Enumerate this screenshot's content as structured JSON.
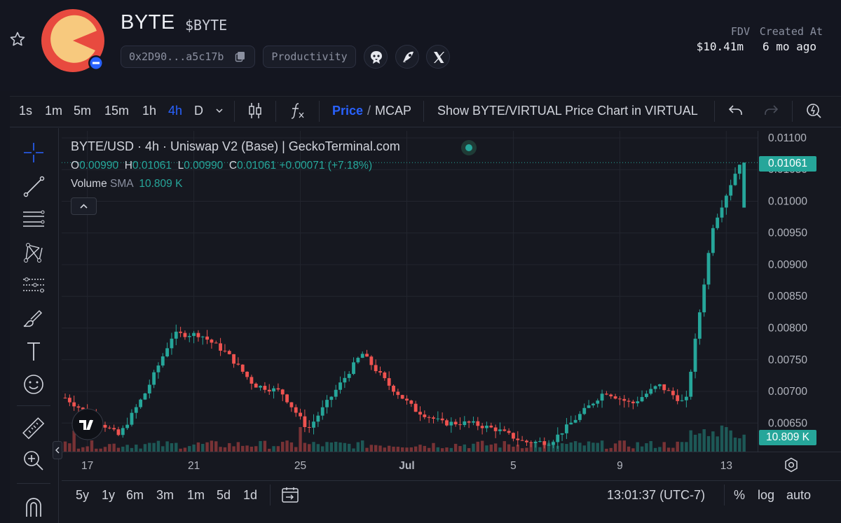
{
  "token": {
    "name": "BYTE",
    "symbol": "$BYTE",
    "address": "0x2D90...a5c17b",
    "category": "Productivity",
    "stats": [
      {
        "label": "FDV",
        "value": "$10.41m"
      },
      {
        "label": "Created At",
        "value": "6 mo ago"
      }
    ],
    "icons": [
      "star-icon",
      "copy-icon",
      "eagle-icon",
      "rocket-icon",
      "x-logo-icon"
    ],
    "logo_colors": {
      "ring": "#e84a3f",
      "face": "#f7c97e",
      "badge": "#2962ff"
    }
  },
  "toolbar": {
    "timeframes": [
      "1s",
      "1m",
      "5m",
      "15m",
      "1h",
      "4h",
      "D"
    ],
    "active_timeframe": "4h",
    "price_label": "Price",
    "slash": "/",
    "mcap_label": "MCAP",
    "show_pair_label": "Show BYTE/VIRTUAL Price Chart in VIRTUAL"
  },
  "legend": {
    "title": "BYTE/USD · 4h · Uniswap V2 (Base) | GeckoTerminal.com",
    "o_label": "O",
    "o": "0.00990",
    "h_label": "H",
    "h": "0.01061",
    "l_label": "L",
    "l": "0.00990",
    "c_label": "C",
    "c": "0.01061",
    "change": "+0.00071 (+7.18%)",
    "volume_label": "Volume",
    "sma_label": "SMA",
    "volume_value": "10.809 K"
  },
  "badges": {
    "price": "0.01061",
    "volume": "10.809 K"
  },
  "range_bar": {
    "ranges": [
      "5y",
      "1y",
      "6m",
      "3m",
      "1m",
      "5d",
      "1d"
    ],
    "time": "13:01:37 (UTC-7)",
    "percent": "%",
    "log": "log",
    "auto": "auto"
  },
  "chart_data": {
    "type": "candlestick",
    "title": "BYTE/USD · 4h · Uniswap V2 (Base) | GeckoTerminal.com",
    "y_ticks": [
      "0.01100",
      "0.01050",
      "0.01000",
      "0.00950",
      "0.00900",
      "0.00850",
      "0.00800",
      "0.00750",
      "0.00700",
      "0.00650"
    ],
    "ylim": [
      0.00605,
      0.01111
    ],
    "x_ticks": [
      {
        "label": "17",
        "index": 5
      },
      {
        "label": "21",
        "index": 29
      },
      {
        "label": "25",
        "index": 53
      },
      {
        "label": "Jul",
        "index": 77
      },
      {
        "label": "5",
        "index": 101
      },
      {
        "label": "9",
        "index": 125
      },
      {
        "label": "13",
        "index": 149
      }
    ],
    "colors": {
      "up": "#26a69a",
      "down": "#ef5350",
      "grid": "#22252e"
    },
    "key_points": [
      [
        0.0069,
        0.0061
      ],
      [
        0.0066,
        0.0065
      ],
      [
        0.0063,
        0.0067
      ],
      [
        0.007,
        0.0065
      ],
      [
        0.0079,
        0.007
      ],
      [
        0.0079,
        0.0076
      ],
      [
        0.0076,
        0.0078
      ],
      [
        0.0071,
        0.0073
      ],
      [
        0.007,
        0.0068
      ],
      [
        0.0064,
        0.0064
      ],
      [
        0.007,
        0.0068
      ],
      [
        0.0076,
        0.0078
      ],
      [
        0.0071,
        0.007
      ],
      [
        0.0067,
        0.0066
      ],
      [
        0.0065,
        0.0066
      ],
      [
        0.0065,
        0.0063
      ],
      [
        0.0064,
        0.0063
      ],
      [
        0.0062,
        0.0063
      ],
      [
        0.0062,
        0.0063
      ],
      [
        0.0066,
        0.0066
      ],
      [
        0.007,
        0.007
      ],
      [
        0.0068,
        0.0066
      ],
      [
        0.0071,
        0.007
      ],
      [
        0.0068,
        0.008
      ],
      [
        0.0096,
        0.01
      ],
      [
        0.01061,
        0.01061
      ]
    ],
    "last": {
      "open": 0.0099,
      "high": 0.01061,
      "low": 0.0099,
      "close": 0.01061
    },
    "volume_sma": "10.809 K"
  }
}
